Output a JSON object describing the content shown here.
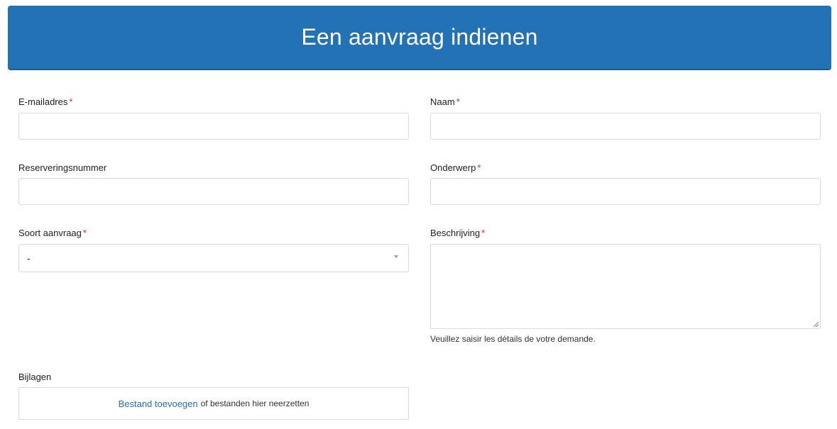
{
  "header": {
    "title": "Een aanvraag indienen"
  },
  "form": {
    "email": {
      "label": "E-mailadres",
      "required": "*",
      "value": ""
    },
    "name": {
      "label": "Naam",
      "required": "*",
      "value": ""
    },
    "reservation": {
      "label": "Reserveringsnummer",
      "value": ""
    },
    "subject": {
      "label": "Onderwerp",
      "required": "*",
      "value": ""
    },
    "request_type": {
      "label": "Soort aanvraag",
      "required": "*",
      "selected": "-"
    },
    "description": {
      "label": "Beschrijving",
      "required": "*",
      "value": "",
      "hint": "Veuillez saisir les détails de votre demande."
    },
    "attachments": {
      "label": "Bijlagen",
      "link_text": "Bestand toevoegen",
      "drop_text": "of bestanden hier neerzetten"
    }
  },
  "colors": {
    "header_bg": "#2272b5",
    "required": "#d9272e",
    "link": "#2272b5"
  }
}
